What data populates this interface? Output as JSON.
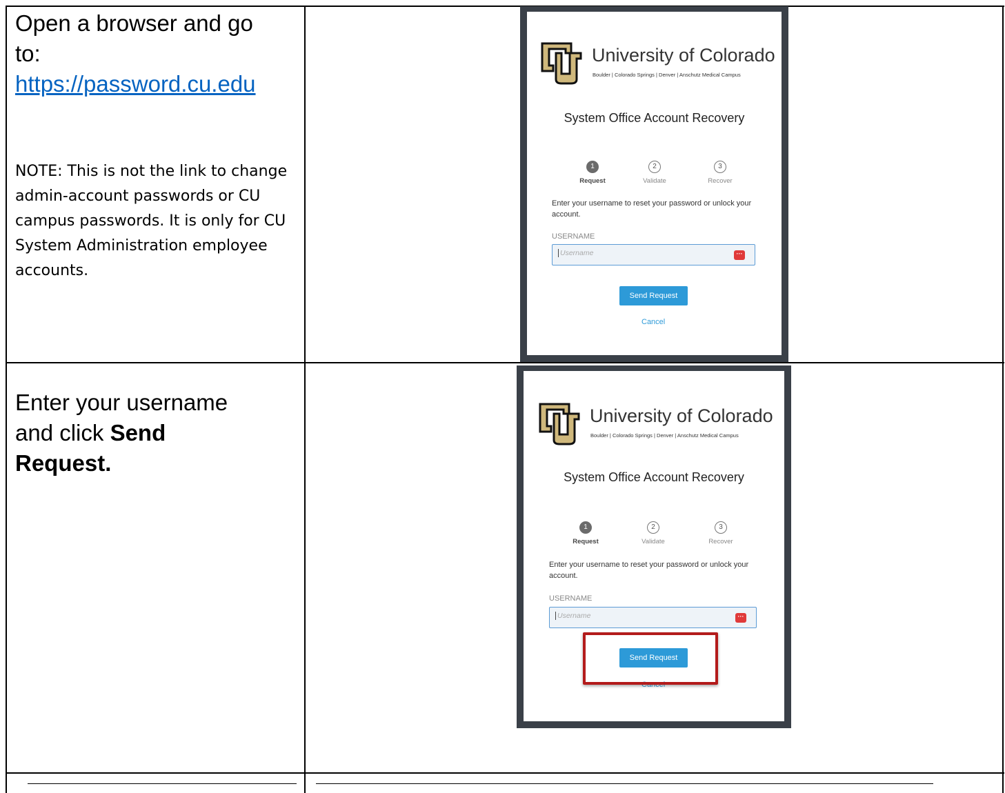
{
  "step1": {
    "instruction_line1": "Open a browser and go",
    "instruction_line2": "to:",
    "url": "https://password.cu.edu",
    "note": "NOTE: This is not the link to change admin-account passwords or CU campus passwords. It is only for CU System Administration employee accounts."
  },
  "step2": {
    "instruction_line1": "Enter your username",
    "instruction_line2_prefix": "and click ",
    "instruction_bold1": "Send",
    "instruction_bold2": "Request."
  },
  "recovery_page": {
    "university_name": "University of Colorado",
    "campuses": "Boulder | Colorado Springs | Denver | Anschutz Medical Campus",
    "heading": "System Office Account Recovery",
    "steps": [
      {
        "number": "1",
        "label": "Request"
      },
      {
        "number": "2",
        "label": "Validate"
      },
      {
        "number": "3",
        "label": "Recover"
      }
    ],
    "instruction": "Enter your username to reset your password or unlock your account.",
    "field_label": "USERNAME",
    "field_placeholder": "Username",
    "send_label": "Send Request",
    "cancel_label": "Cancel"
  },
  "colors": {
    "link": "#0563c1",
    "button": "#2d9ad8",
    "highlight": "#b31b1b",
    "frame": "#3a4048",
    "cu_gold": "#cfb87c"
  }
}
